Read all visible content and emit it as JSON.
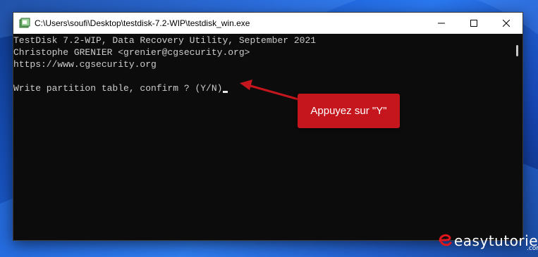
{
  "window": {
    "title": "C:\\Users\\soufi\\Desktop\\testdisk-7.2-WIP\\testdisk_win.exe",
    "icon": "console-app-icon"
  },
  "console": {
    "lines": [
      "TestDisk 7.2-WIP, Data Recovery Utility, September 2021",
      "Christophe GRENIER <grenier@cgsecurity.org>",
      "https://www.cgsecurity.org",
      "",
      "Write partition table, confirm ? (Y/N)"
    ]
  },
  "annotation": {
    "label": "Appuyez sur \"Y\"",
    "color": "#c4161c"
  },
  "watermark": {
    "name": "easytutoriel",
    "suffix": ".com"
  }
}
